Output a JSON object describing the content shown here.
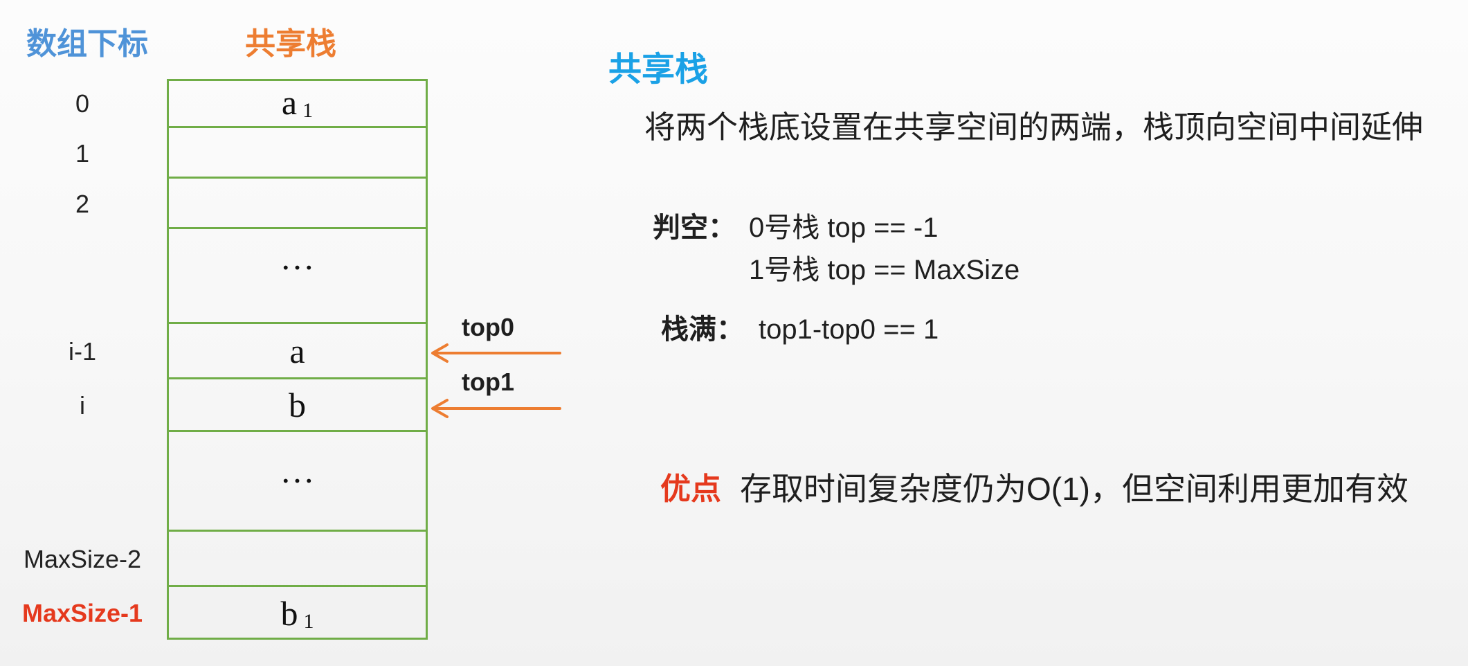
{
  "header": {
    "index_title": "数组下标",
    "stack_title": "共享栈"
  },
  "stack": {
    "rows": [
      {
        "index": "0",
        "value": "a",
        "sub": "1"
      },
      {
        "index": "1"
      },
      {
        "index": "2"
      },
      {
        "value": "…"
      },
      {
        "index": "i-1",
        "value": "a"
      },
      {
        "index": "i",
        "value": "b"
      },
      {
        "value": "…"
      },
      {
        "index": "MaxSize-2"
      },
      {
        "index": "MaxSize-1",
        "value": "b",
        "sub": "1"
      }
    ]
  },
  "pointers": [
    {
      "label": "top0"
    },
    {
      "label": "top1"
    }
  ],
  "info": {
    "title": "共享栈",
    "description": "将两个栈底设置在共享空间的两端，栈顶向空间中间延伸",
    "empty_check": {
      "label": "判空：",
      "lines": [
        "0号栈 top == -1",
        "1号栈 top == MaxSize"
      ]
    },
    "full_check": {
      "label": "栈满：",
      "text": "top1-top0 == 1"
    },
    "advantage": {
      "label": "优点",
      "text": "存取时间复杂度仍为O(1)，但空间利用更加有效"
    }
  },
  "colors": {
    "index_title": "#4f93d8",
    "stack_title": "#ed7d31",
    "stack_border": "#70ad47",
    "pointer": "#ed7d31",
    "info_title": "#1aa1e6",
    "highlight_red": "#e5391d"
  }
}
